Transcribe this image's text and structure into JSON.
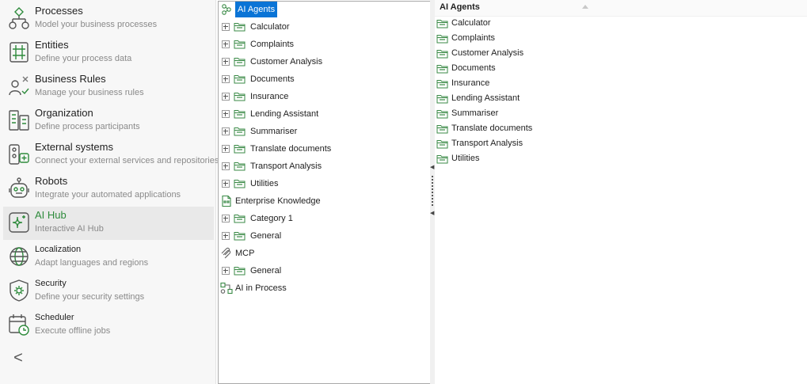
{
  "sidebar": {
    "items": [
      {
        "title": "Processes",
        "subtitle": "Model your business processes"
      },
      {
        "title": "Entities",
        "subtitle": "Define your process data"
      },
      {
        "title": "Business Rules",
        "subtitle": "Manage your business rules"
      },
      {
        "title": "Organization",
        "subtitle": "Define process participants"
      },
      {
        "title": "External systems",
        "subtitle": "Connect your external services and repositories"
      },
      {
        "title": "Robots",
        "subtitle": "Integrate your automated applications"
      },
      {
        "title": "AI Hub",
        "subtitle": "Interactive AI Hub"
      },
      {
        "title": "Localization",
        "subtitle": "Adapt languages and regions"
      },
      {
        "title": "Security",
        "subtitle": "Define your security settings"
      },
      {
        "title": "Scheduler",
        "subtitle": "Execute offline jobs"
      }
    ],
    "active_index": 6,
    "collapse_glyph": "<"
  },
  "tree": {
    "ai_agents": {
      "label": "AI Agents",
      "children": [
        "Calculator",
        "Complaints",
        "Customer Analysis",
        "Documents",
        "Insurance",
        "Lending Assistant",
        "Summariser",
        "Translate documents",
        "Transport Analysis",
        "Utilities"
      ]
    },
    "enterprise_knowledge": {
      "label": "Enterprise Knowledge",
      "children": [
        "Category 1",
        "General"
      ]
    },
    "mcp": {
      "label": "MCP",
      "children": [
        "General"
      ]
    },
    "ai_in_process": {
      "label": "AI in Process"
    }
  },
  "list": {
    "header": "AI Agents",
    "items": [
      "Calculator",
      "Complaints",
      "Customer Analysis",
      "Documents",
      "Insurance",
      "Lending Assistant",
      "Summariser",
      "Translate documents",
      "Transport Analysis",
      "Utilities"
    ]
  },
  "colors": {
    "accent_green": "#2e8b3c",
    "selection_blue": "#0a74d6",
    "folder_green": "#3a8a46"
  },
  "icons": {
    "processes": "process-flow-icon",
    "entities": "entity-grid-icon",
    "business_rules": "rules-icon",
    "organization": "organization-icon",
    "external_systems": "external-systems-icon",
    "robots": "robot-icon",
    "ai_hub": "ai-sparkle-icon",
    "localization": "globe-icon",
    "security": "shield-gear-icon",
    "scheduler": "calendar-clock-icon",
    "folder": "folder-icon"
  }
}
